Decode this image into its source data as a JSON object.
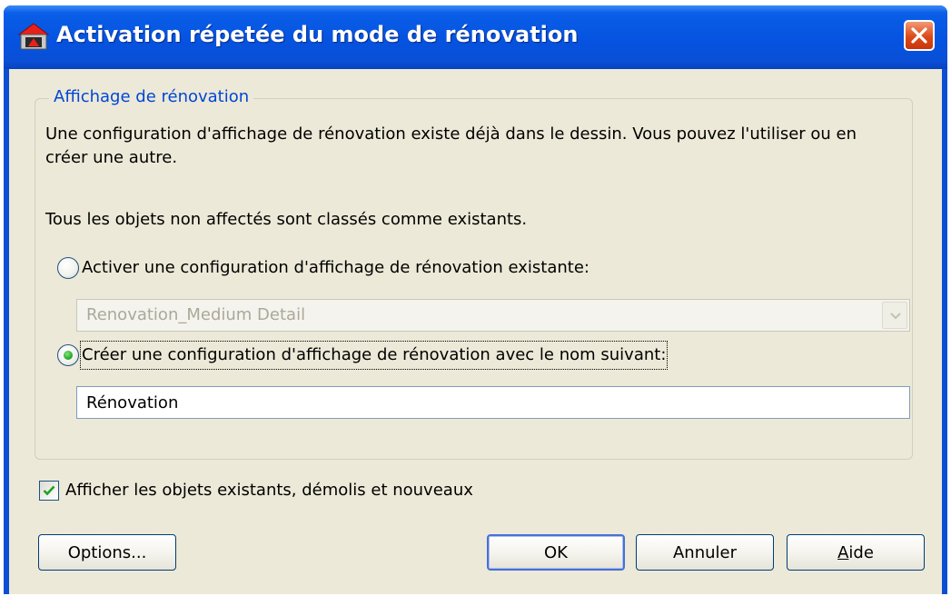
{
  "window": {
    "title": "Activation répetée du mode de rénovation",
    "icon": "autocad-app-icon",
    "close_icon": "close-icon"
  },
  "group": {
    "legend": "Affichage de rénovation",
    "description_line1": "Une configuration d'affichage de rénovation existe déjà dans le dessin. Vous pouvez l'utiliser ou en",
    "description_line2": "créer une autre.",
    "note": "Tous les objets non affectés sont classés comme existants.",
    "option_existing": {
      "label": "Activer une configuration d'affichage de rénovation existante:",
      "selected": false
    },
    "existing_config_select": {
      "value": "Renovation_Medium Detail",
      "enabled": false
    },
    "option_new": {
      "label": "Créer une configuration d'affichage de rénovation avec le nom suivant:",
      "selected": true
    },
    "new_name_input": {
      "value": "Rénovation"
    }
  },
  "show_objects_checkbox": {
    "label": "Afficher les objets existants, démolis et nouveaux",
    "checked": true
  },
  "buttons": {
    "options": "Options...",
    "ok": "OK",
    "cancel": "Annuler",
    "help": "Aide"
  },
  "colors": {
    "titlebar": "#0553e0",
    "dialog_background": "#ece9d8",
    "group_legend": "#0046d5",
    "radio_selected": "#21a121"
  }
}
